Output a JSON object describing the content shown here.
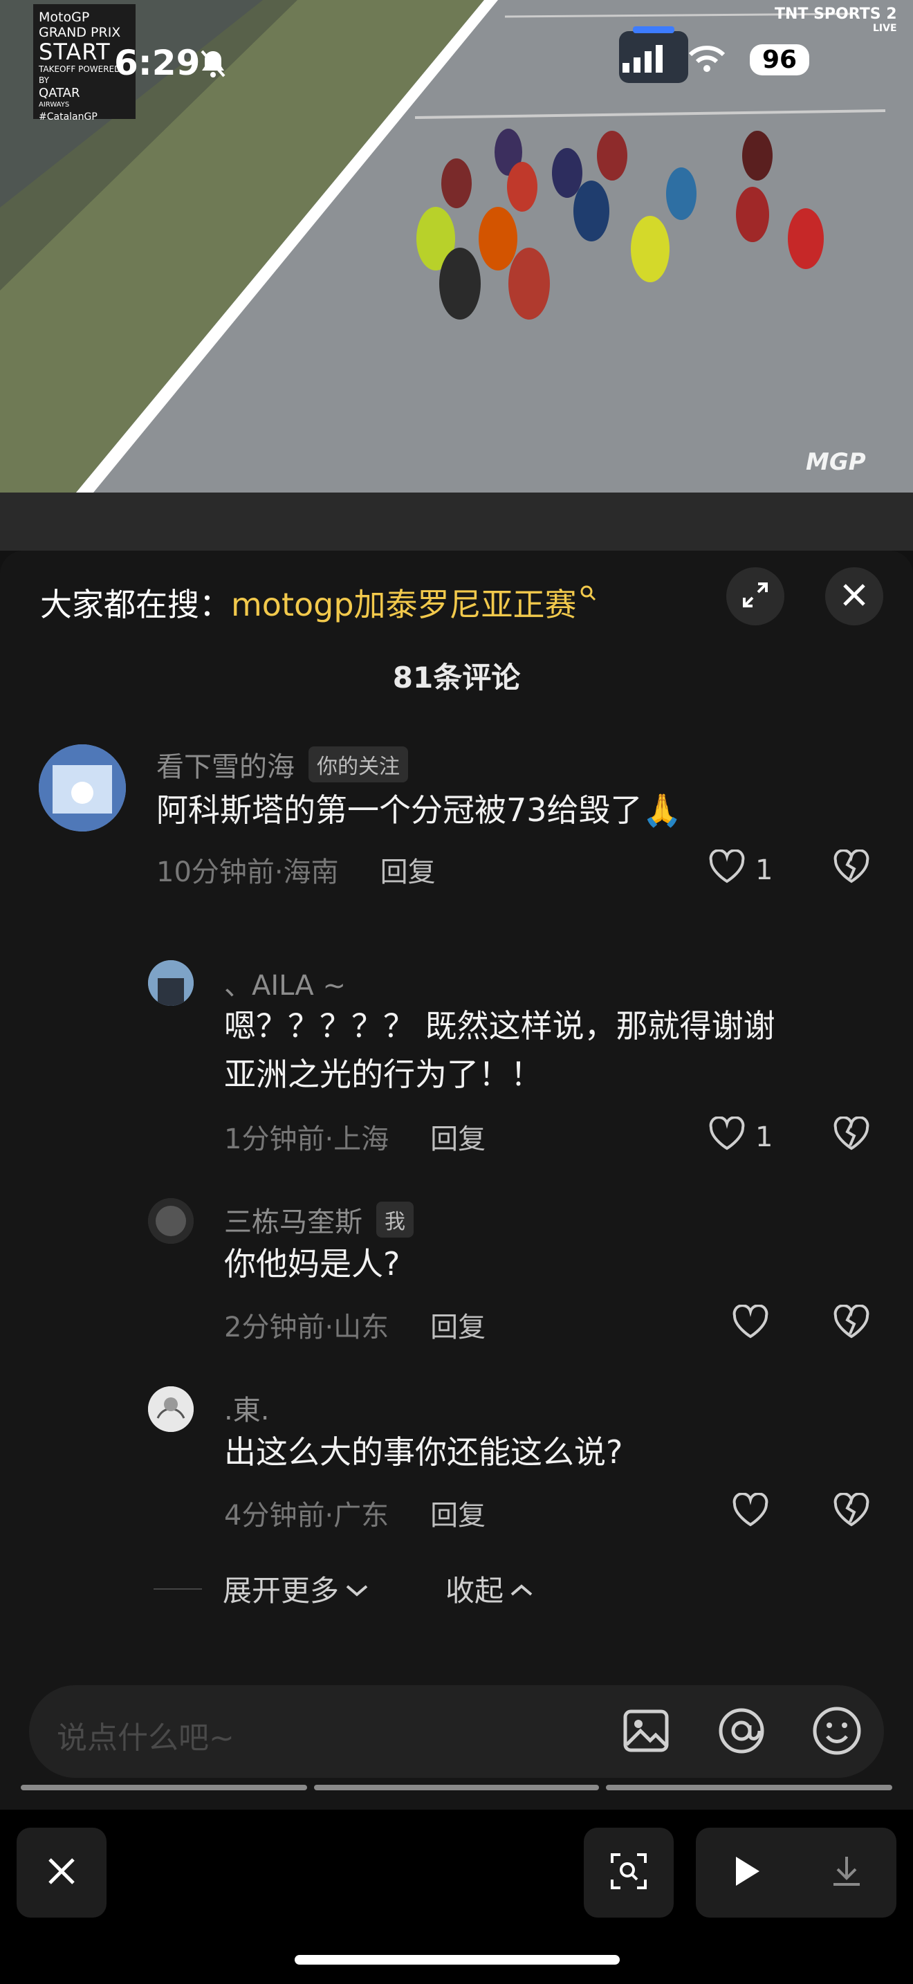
{
  "video": {
    "logo_lines": [
      "MotoGP",
      "GRAND PRIX",
      "START",
      "TAKEOFF POWERED BY",
      "QATAR",
      "AIRWAYS",
      "#CatalanGP"
    ],
    "broadcaster": "TNT SPORTS 2",
    "broadcaster_badge": "LIVE",
    "watermark": "MGP"
  },
  "status_bar": {
    "time": "6:29",
    "battery": "96"
  },
  "panel": {
    "search_prefix": "大家都在搜：",
    "search_term": "motogp加泰罗尼亚正赛",
    "comment_count": "81条评论"
  },
  "comments": [
    {
      "username": "看下雪的海",
      "tag": "你的关注",
      "text": "阿科斯塔的第一个分冠被73给毁了🙏",
      "time_location": "10分钟前·海南",
      "reply_label": "回复",
      "likes": "1"
    },
    {
      "username": "、AILA ~",
      "text_line1": "嗯？？？？？ 既然这样说，那就得谢谢",
      "text_line2": "亚洲之光的行为了！！",
      "time_location": "1分钟前·上海",
      "reply_label": "回复",
      "likes": "1"
    },
    {
      "username": "三栋马奎斯",
      "tag": "我",
      "text": "你他妈是人?",
      "time_location": "2分钟前·山东",
      "reply_label": "回复"
    },
    {
      "username": ".東.",
      "text": "出这么大的事你还能这么说?",
      "time_location": "4分钟前·广东",
      "reply_label": "回复"
    }
  ],
  "thread_controls": {
    "expand_more": "展开更多",
    "collapse": "收起"
  },
  "input": {
    "placeholder": "说点什么吧~"
  },
  "icons": {
    "expand": "expand-icon",
    "close": "close-icon",
    "image": "image-icon",
    "mention": "at-icon",
    "emoji": "emoji-icon",
    "like": "heart-icon",
    "dislike": "broken-heart-icon",
    "scan": "scan-icon",
    "play": "play-icon",
    "download": "download-icon"
  }
}
